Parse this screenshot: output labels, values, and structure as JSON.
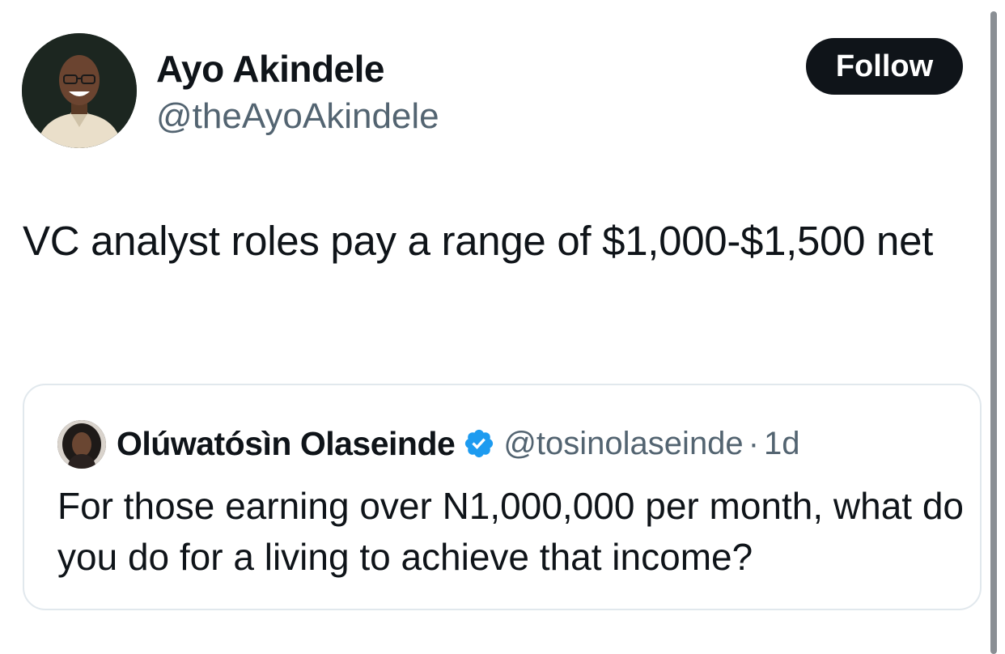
{
  "tweet": {
    "author": {
      "display_name": "Ayo Akindele",
      "handle": "@theAyoAkindele"
    },
    "follow_label": "Follow",
    "text": "VC analyst roles pay a range of $1,000-$1,500 net"
  },
  "quoted_tweet": {
    "author": {
      "display_name": "Olúwatósìn Olaseinde",
      "handle": "@tosinolaseinde",
      "verified": true
    },
    "separator": "·",
    "time": "1d",
    "text": "For those earning over N1,000,000 per month, what do you do for a living to achieve that income?"
  },
  "colors": {
    "text": "#0f1419",
    "secondary": "#536471",
    "follow_bg": "#0f1419",
    "verified": "#1d9bf0",
    "card_border": "#e1e8ed"
  }
}
